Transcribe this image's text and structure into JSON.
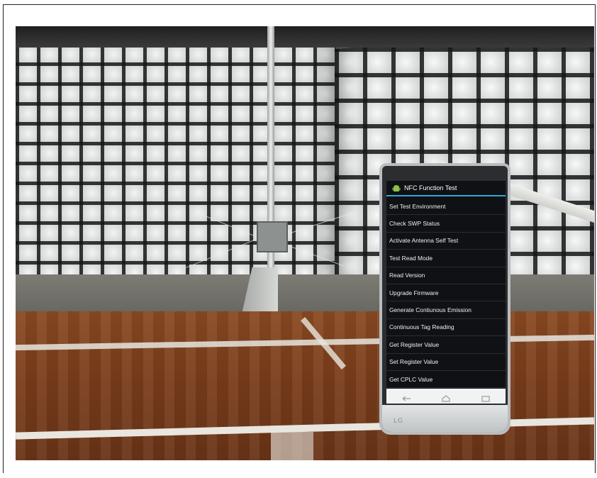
{
  "phone": {
    "brand": "LG"
  },
  "app": {
    "title": "NFC Function Test",
    "title_icon": "android-icon",
    "accent_color": "#2fa7d6",
    "menu_items": [
      {
        "label": "Set Test Environment"
      },
      {
        "label": "Check SWP Status"
      },
      {
        "label": "Activate Antenna Self Test"
      },
      {
        "label": "Test Read Mode"
      },
      {
        "label": "Read Version"
      },
      {
        "label": "Upgrade Firmware"
      },
      {
        "label": "Generate Contiunous Emission"
      },
      {
        "label": "Continuous Tag Reading"
      },
      {
        "label": "Get Register Value"
      },
      {
        "label": "Set Register Value"
      },
      {
        "label": "Get CPLC Value"
      }
    ]
  },
  "navbar": {
    "icons": [
      "back-icon",
      "home-icon",
      "recent-apps-icon"
    ]
  }
}
